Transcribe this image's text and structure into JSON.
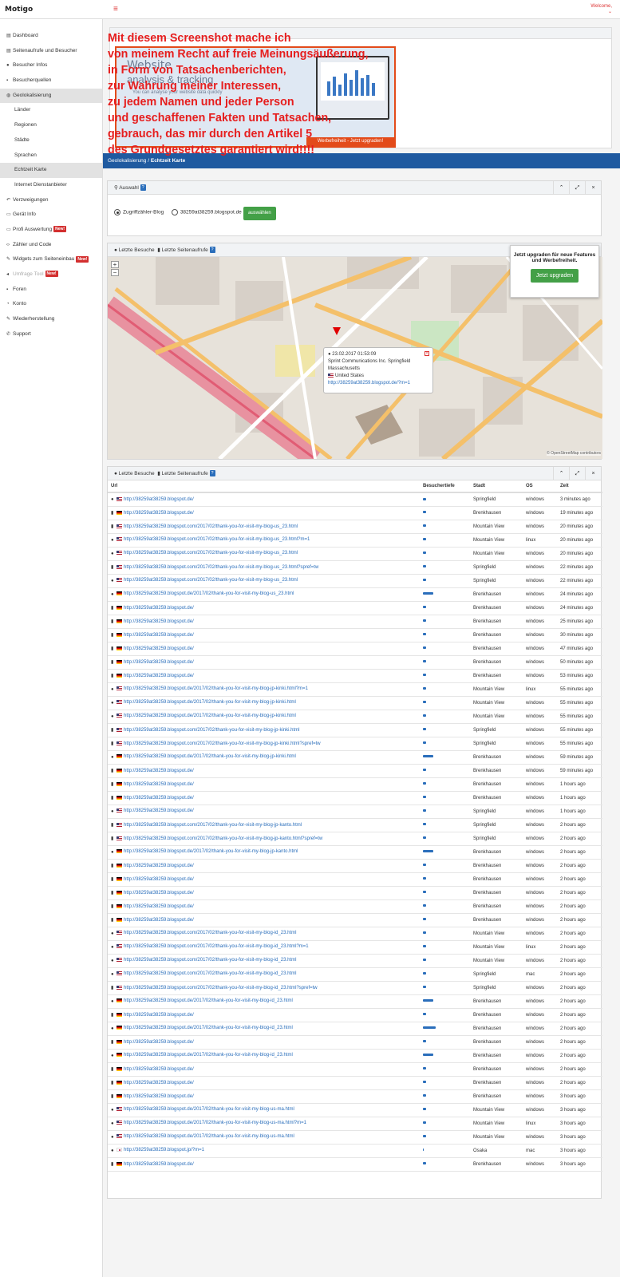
{
  "topbar": {
    "logo": "Motigo",
    "menu_icon": "≡",
    "welcome": "Welcome,",
    "welcome_caret": "⌄"
  },
  "sidebar": {
    "items": [
      {
        "label": "Dashboard",
        "icon": "▤",
        "icon_name": "dashboard-icon",
        "sub": false,
        "active": false
      },
      {
        "label": "Seitenaufrufe und Besucher",
        "icon": "▤",
        "icon_name": "chart-icon",
        "sub": false,
        "active": false
      },
      {
        "label": "Besucher Infos",
        "icon": "●",
        "icon_name": "user-icon",
        "sub": false,
        "active": false
      },
      {
        "label": "Besucherquellen",
        "icon": "▪",
        "icon_name": "source-icon",
        "sub": false,
        "active": false
      },
      {
        "label": "Geolokalisierung",
        "icon": "◍",
        "icon_name": "globe-icon",
        "sub": false,
        "active": true
      },
      {
        "label": "Länder",
        "icon": "",
        "icon_name": "",
        "sub": true,
        "active": false
      },
      {
        "label": "Regionen",
        "icon": "",
        "icon_name": "",
        "sub": true,
        "active": false
      },
      {
        "label": "Städte",
        "icon": "",
        "icon_name": "",
        "sub": true,
        "active": false
      },
      {
        "label": "Sprachen",
        "icon": "",
        "icon_name": "",
        "sub": true,
        "active": false
      },
      {
        "label": "Echtzeit Karte",
        "icon": "",
        "icon_name": "",
        "sub": true,
        "active": true
      },
      {
        "label": "Internet Dienstanbieter",
        "icon": "",
        "icon_name": "",
        "sub": true,
        "active": false
      },
      {
        "label": "Verzweigungen",
        "icon": "↶",
        "icon_name": "branch-icon",
        "sub": false,
        "active": false
      },
      {
        "label": "Gerät Info",
        "icon": "▭",
        "icon_name": "device-icon",
        "sub": false,
        "active": false
      },
      {
        "label": "Profi Auswertung",
        "icon": "▭",
        "icon_name": "monitor-icon",
        "sub": false,
        "active": false,
        "badge": "New!"
      },
      {
        "label": "Zähler und Code",
        "icon": "‹›",
        "icon_name": "code-icon",
        "sub": false,
        "active": false
      },
      {
        "label": "Widgets zum Seiteneinbau",
        "icon": "✎",
        "icon_name": "widget-icon",
        "sub": false,
        "active": false,
        "badge": "New!"
      },
      {
        "label": "Umfrage Tool",
        "icon": "◂",
        "icon_name": "megaphone-icon",
        "sub": false,
        "active": false,
        "dim": true,
        "badge": "New!"
      },
      {
        "label": "Foren",
        "icon": "▪",
        "icon_name": "forum-icon",
        "sub": false,
        "active": false
      },
      {
        "label": "Konto",
        "icon": "◔",
        "icon_name": "account-icon",
        "sub": false,
        "active": false
      },
      {
        "label": "Wiederherstellung",
        "icon": "✎",
        "icon_name": "wrench-icon",
        "sub": false,
        "active": false
      },
      {
        "label": "Support",
        "icon": "✆",
        "icon_name": "phone-icon",
        "sub": false,
        "active": false
      }
    ]
  },
  "ad": {
    "title": "Website",
    "subtitle": "analysis & tracking",
    "text": "You can analyse your website data quickly",
    "button": "Werbefreiheit - Jetzt upgraden!"
  },
  "overlay_lines": [
    "Mit diesem Screenshot mache ich",
    "von meinem Recht auf freie Meinungsäußerung,",
    "in Form von Tatsachenberichten,",
    "zur Wahrung meiner Interessen,",
    "zu jedem Namen und jeder Person",
    "und geschaffenen Fakten und Tatsachen,",
    "gebrauch, das mir durch den Artikel 5",
    "des Grundgesetztes garantiert wird!!!!"
  ],
  "breadcrumb": {
    "parent": "Geolokalisierung",
    "separator": "/",
    "current": "Echtzeit Karte"
  },
  "auswahl": {
    "title": "Auswahl",
    "help": "?",
    "options": [
      "Zugriffzähler-Blog",
      "38259at38259.blogspot.de"
    ],
    "selected": 0,
    "button": "auswählen"
  },
  "panel_tabs": {
    "tab1": "Letzte Besuche",
    "tab2": "Letzte Seitenaufrufe",
    "help": "?"
  },
  "tools": {
    "collapse": "⌃",
    "expand": "⤢",
    "close": "×"
  },
  "map": {
    "zoom_in": "+",
    "zoom_out": "−",
    "upgrade_text": "Jetzt upgraden für neue Features und Werbefreiheit.",
    "upgrade_button": "Jetzt upgraden",
    "popup": {
      "time": "23.02.2017 01:53:09",
      "isp": "Sprint Communications Inc. Springfield",
      "region": "Massachusetts",
      "country": "United States",
      "url": "http://38259at38259.blogspot.de/?m=1"
    },
    "attribution": "© OpenStreetMap contributors",
    "labels": [
      "Springfield",
      "Court Street",
      "Main Street",
      "State Street",
      "Pynchon Street",
      "East Columbus Avenue",
      "West Columbus Avenue",
      "City Hall Place",
      "Stockbridge St",
      "Springfield Post Office",
      "First Church of Christ Scientist",
      "CityStage Symphony Hall",
      "First Hebrew Episcopal",
      "Springfield Museums",
      "Pearl Street",
      "291",
      "I 91"
    ]
  },
  "table": {
    "headers": [
      "Url",
      "Besuchertiefe",
      "Stadt",
      "OS",
      "Zeit"
    ],
    "rows": [
      {
        "vt": "user",
        "fl": "us",
        "url": "http://38259at38259.blogspot.de/",
        "d": 1,
        "city": "Springfield",
        "os": "windows",
        "time": "3 minutes ago"
      },
      {
        "vt": "file",
        "fl": "de",
        "url": "http://38259at38259.blogspot.de/",
        "d": 1,
        "city": "Brenkhausen",
        "os": "windows",
        "time": "19 minutes ago"
      },
      {
        "vt": "file",
        "fl": "us",
        "url": "http://38259at38259.blogspot.com/2017/02/thank-you-for-visit-my-blog-us_23.html",
        "d": 1,
        "city": "Mountain View",
        "os": "windows",
        "time": "20 minutes ago"
      },
      {
        "vt": "user",
        "fl": "us",
        "url": "http://38259at38259.blogspot.com/2017/02/thank-you-for-visit-my-blog-us_23.html?m=1",
        "d": 1,
        "city": "Mountain View",
        "os": "linux",
        "time": "20 minutes ago"
      },
      {
        "vt": "user",
        "fl": "us",
        "url": "http://38259at38259.blogspot.com/2017/02/thank-you-for-visit-my-blog-us_23.html",
        "d": 1,
        "city": "Mountain View",
        "os": "windows",
        "time": "20 minutes ago"
      },
      {
        "vt": "file",
        "fl": "us",
        "url": "http://38259at38259.blogspot.com/2017/02/thank-you-for-visit-my-blog-us_23.html?spref=tw",
        "d": 1,
        "city": "Springfield",
        "os": "windows",
        "time": "22 minutes ago"
      },
      {
        "vt": "user",
        "fl": "us",
        "url": "http://38259at38259.blogspot.com/2017/02/thank-you-for-visit-my-blog-us_23.html",
        "d": 1,
        "city": "Springfield",
        "os": "windows",
        "time": "22 minutes ago"
      },
      {
        "vt": "user",
        "fl": "de",
        "url": "http://38259at38259.blogspot.de/2017/02/thank-you-for-visit-my-blog-us_23.html",
        "d": 4,
        "city": "Brenkhausen",
        "os": "windows",
        "time": "24 minutes ago"
      },
      {
        "vt": "file",
        "fl": "de",
        "url": "http://38259at38259.blogspot.de/",
        "d": 1,
        "city": "Brenkhausen",
        "os": "windows",
        "time": "24 minutes ago"
      },
      {
        "vt": "file",
        "fl": "de",
        "url": "http://38259at38259.blogspot.de/",
        "d": 1,
        "city": "Brenkhausen",
        "os": "windows",
        "time": "25 minutes ago"
      },
      {
        "vt": "file",
        "fl": "de",
        "url": "http://38259at38259.blogspot.de/",
        "d": 1,
        "city": "Brenkhausen",
        "os": "windows",
        "time": "30 minutes ago"
      },
      {
        "vt": "file",
        "fl": "de",
        "url": "http://38259at38259.blogspot.de/",
        "d": 1,
        "city": "Brenkhausen",
        "os": "windows",
        "time": "47 minutes ago"
      },
      {
        "vt": "file",
        "fl": "de",
        "url": "http://38259at38259.blogspot.de/",
        "d": 1,
        "city": "Brenkhausen",
        "os": "windows",
        "time": "50 minutes ago"
      },
      {
        "vt": "file",
        "fl": "de",
        "url": "http://38259at38259.blogspot.de/",
        "d": 1,
        "city": "Brenkhausen",
        "os": "windows",
        "time": "53 minutes ago"
      },
      {
        "vt": "user",
        "fl": "us",
        "url": "http://38259at38259.blogspot.de/2017/02/thank-you-for-visit-my-blog-jp-kinki.html?m=1",
        "d": 1,
        "city": "Mountain View",
        "os": "linux",
        "time": "55 minutes ago"
      },
      {
        "vt": "user",
        "fl": "us",
        "url": "http://38259at38259.blogspot.de/2017/02/thank-you-for-visit-my-blog-jp-kinki.html",
        "d": 1,
        "city": "Mountain View",
        "os": "windows",
        "time": "55 minutes ago"
      },
      {
        "vt": "user",
        "fl": "us",
        "url": "http://38259at38259.blogspot.de/2017/02/thank-you-for-visit-my-blog-jp-kinki.html",
        "d": 1,
        "city": "Mountain View",
        "os": "windows",
        "time": "55 minutes ago"
      },
      {
        "vt": "file",
        "fl": "us",
        "url": "http://38259at38259.blogspot.com/2017/02/thank-you-for-visit-my-blog-jp-kinki.html",
        "d": 1,
        "city": "Springfield",
        "os": "windows",
        "time": "55 minutes ago"
      },
      {
        "vt": "file",
        "fl": "us",
        "url": "http://38259at38259.blogspot.com/2017/02/thank-you-for-visit-my-blog-jp-kinki.html?spref=tw",
        "d": 1,
        "city": "Springfield",
        "os": "windows",
        "time": "55 minutes ago"
      },
      {
        "vt": "user",
        "fl": "de",
        "url": "http://38259at38259.blogspot.de/2017/02/thank-you-for-visit-my-blog-jp-kinki.html",
        "d": 4,
        "city": "Brenkhausen",
        "os": "windows",
        "time": "59 minutes ago"
      },
      {
        "vt": "file",
        "fl": "de",
        "url": "http://38259at38259.blogspot.de/",
        "d": 1,
        "city": "Brenkhausen",
        "os": "windows",
        "time": "59 minutes ago"
      },
      {
        "vt": "file",
        "fl": "de",
        "url": "http://38259at38259.blogspot.de/",
        "d": 1,
        "city": "Brenkhausen",
        "os": "windows",
        "time": "1 hours ago"
      },
      {
        "vt": "file",
        "fl": "de",
        "url": "http://38259at38259.blogspot.de/",
        "d": 1,
        "city": "Brenkhausen",
        "os": "windows",
        "time": "1 hours ago"
      },
      {
        "vt": "user",
        "fl": "us",
        "url": "http://38259at38259.blogspot.de/",
        "d": 1,
        "city": "Springfield",
        "os": "windows",
        "time": "1 hours ago"
      },
      {
        "vt": "file",
        "fl": "us",
        "url": "http://38259at38259.blogspot.com/2017/02/thank-you-for-visit-my-blog-jp-kanto.html",
        "d": 1,
        "city": "Springfield",
        "os": "windows",
        "time": "2 hours ago"
      },
      {
        "vt": "file",
        "fl": "us",
        "url": "http://38259at38259.blogspot.com/2017/02/thank-you-for-visit-my-blog-jp-kanto.html?spref=tw",
        "d": 1,
        "city": "Springfield",
        "os": "windows",
        "time": "2 hours ago"
      },
      {
        "vt": "user",
        "fl": "de",
        "url": "http://38259at38259.blogspot.de/2017/02/thank-you-for-visit-my-blog-jp-kanto.html",
        "d": 4,
        "city": "Brenkhausen",
        "os": "windows",
        "time": "2 hours ago"
      },
      {
        "vt": "file",
        "fl": "de",
        "url": "http://38259at38259.blogspot.de/",
        "d": 1,
        "city": "Brenkhausen",
        "os": "windows",
        "time": "2 hours ago"
      },
      {
        "vt": "file",
        "fl": "de",
        "url": "http://38259at38259.blogspot.de/",
        "d": 1,
        "city": "Brenkhausen",
        "os": "windows",
        "time": "2 hours ago"
      },
      {
        "vt": "file",
        "fl": "de",
        "url": "http://38259at38259.blogspot.de/",
        "d": 1,
        "city": "Brenkhausen",
        "os": "windows",
        "time": "2 hours ago"
      },
      {
        "vt": "file",
        "fl": "de",
        "url": "http://38259at38259.blogspot.de/",
        "d": 1,
        "city": "Brenkhausen",
        "os": "windows",
        "time": "2 hours ago"
      },
      {
        "vt": "file",
        "fl": "de",
        "url": "http://38259at38259.blogspot.de/",
        "d": 1,
        "city": "Brenkhausen",
        "os": "windows",
        "time": "2 hours ago"
      },
      {
        "vt": "user",
        "fl": "us",
        "url": "http://38259at38259.blogspot.com/2017/02/thank-you-for-visit-my-blog-id_23.html",
        "d": 1,
        "city": "Mountain View",
        "os": "windows",
        "time": "2 hours ago"
      },
      {
        "vt": "user",
        "fl": "us",
        "url": "http://38259at38259.blogspot.com/2017/02/thank-you-for-visit-my-blog-id_23.html?m=1",
        "d": 1,
        "city": "Mountain View",
        "os": "linux",
        "time": "2 hours ago"
      },
      {
        "vt": "user",
        "fl": "us",
        "url": "http://38259at38259.blogspot.com/2017/02/thank-you-for-visit-my-blog-id_23.html",
        "d": 1,
        "city": "Mountain View",
        "os": "windows",
        "time": "2 hours ago"
      },
      {
        "vt": "user",
        "fl": "us",
        "url": "http://38259at38259.blogspot.com/2017/02/thank-you-for-visit-my-blog-id_23.html",
        "d": 1,
        "city": "Springfield",
        "os": "mac",
        "time": "2 hours ago"
      },
      {
        "vt": "file",
        "fl": "us",
        "url": "http://38259at38259.blogspot.com/2017/02/thank-you-for-visit-my-blog-id_23.html?spref=tw",
        "d": 1,
        "city": "Springfield",
        "os": "windows",
        "time": "2 hours ago"
      },
      {
        "vt": "user",
        "fl": "de",
        "url": "http://38259at38259.blogspot.de/2017/02/thank-you-for-visit-my-blog-id_23.html",
        "d": 4,
        "city": "Brenkhausen",
        "os": "windows",
        "time": "2 hours ago"
      },
      {
        "vt": "file",
        "fl": "de",
        "url": "http://38259at38259.blogspot.de/",
        "d": 1,
        "city": "Brenkhausen",
        "os": "windows",
        "time": "2 hours ago"
      },
      {
        "vt": "user",
        "fl": "de",
        "url": "http://38259at38259.blogspot.de/2017/02/thank-you-for-visit-my-blog-id_23.html",
        "d": 5,
        "city": "Brenkhausen",
        "os": "windows",
        "time": "2 hours ago"
      },
      {
        "vt": "file",
        "fl": "de",
        "url": "http://38259at38259.blogspot.de/",
        "d": 1,
        "city": "Brenkhausen",
        "os": "windows",
        "time": "2 hours ago"
      },
      {
        "vt": "user",
        "fl": "de",
        "url": "http://38259at38259.blogspot.de/2017/02/thank-you-for-visit-my-blog-id_23.html",
        "d": 4,
        "city": "Brenkhausen",
        "os": "windows",
        "time": "2 hours ago"
      },
      {
        "vt": "file",
        "fl": "de",
        "url": "http://38259at38259.blogspot.de/",
        "d": 1,
        "city": "Brenkhausen",
        "os": "windows",
        "time": "2 hours ago"
      },
      {
        "vt": "file",
        "fl": "de",
        "url": "http://38259at38259.blogspot.de/",
        "d": 1,
        "city": "Brenkhausen",
        "os": "windows",
        "time": "2 hours ago"
      },
      {
        "vt": "file",
        "fl": "de",
        "url": "http://38259at38259.blogspot.de/",
        "d": 1,
        "city": "Brenkhausen",
        "os": "windows",
        "time": "3 hours ago"
      },
      {
        "vt": "user",
        "fl": "us",
        "url": "http://38259at38259.blogspot.de/2017/02/thank-you-for-visit-my-blog-us-ma.html",
        "d": 1,
        "city": "Mountain View",
        "os": "windows",
        "time": "3 hours ago"
      },
      {
        "vt": "user",
        "fl": "us",
        "url": "http://38259at38259.blogspot.de/2017/02/thank-you-for-visit-my-blog-us-ma.html?m=1",
        "d": 1,
        "city": "Mountain View",
        "os": "linux",
        "time": "3 hours ago"
      },
      {
        "vt": "user",
        "fl": "us",
        "url": "http://38259at38259.blogspot.de/2017/02/thank-you-for-visit-my-blog-us-ma.html",
        "d": 1,
        "city": "Mountain View",
        "os": "windows",
        "time": "3 hours ago"
      },
      {
        "vt": "user",
        "fl": "jp",
        "url": "http://38259at38259.blogspot.jp/?m=1",
        "d": 0,
        "city": "Osaka",
        "os": "mac",
        "time": "3 hours ago"
      },
      {
        "vt": "file",
        "fl": "de",
        "url": "http://38259at38259.blogspot.de/",
        "d": 1,
        "city": "Brenkhausen",
        "os": "windows",
        "time": "3 hours ago"
      }
    ]
  },
  "colors": {
    "accent": "#1f5aa0",
    "link": "#2a6ebb",
    "danger": "#d32f2f",
    "success": "#43a047",
    "overlay": "#e61e1e"
  }
}
